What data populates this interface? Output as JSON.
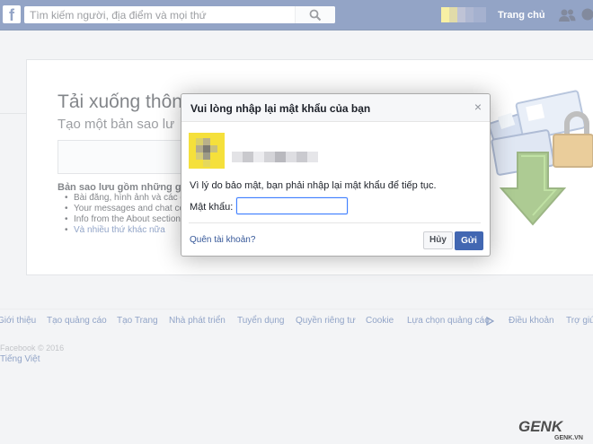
{
  "topbar": {
    "logo_letter": "f",
    "search_placeholder": "Tìm kiếm người, địa điểm và mọi thứ",
    "home_label": "Trang chủ"
  },
  "page": {
    "title": "Tải xuống thôn",
    "subtitle": "Tạo một bản sao lư",
    "backup_title": "Bản sao lưu gồm những g",
    "bullets": [
      "Bài đăng, hình ảnh và các đ",
      "Your messages and chat con",
      "Info from the About section o",
      "Và nhiều thứ khác nữa"
    ]
  },
  "footer": {
    "links": [
      "Giới thiệu",
      "Tạo quảng cáo",
      "Tạo Trang",
      "Nhà phát triển",
      "Tuyển dụng",
      "Quyền riêng tư",
      "Cookie",
      "Lựa chọn quảng cáo",
      "Điều khoản",
      "Trợ giú"
    ],
    "copyright": "Facebook © 2016",
    "language": "Tiếng Việt"
  },
  "modal": {
    "title": "Vui lòng nhập lại mật khẩu của bạn",
    "close_glyph": "×",
    "message": "Vì lý do bảo mật, bạn phải nhập lại mật khẩu để tiếp tục.",
    "password_label": "Mật khẩu:",
    "password_value": "",
    "forgot_link": "Quên tài khoản?",
    "cancel_label": "Hủy",
    "send_label": "Gửi"
  },
  "watermark": {
    "brand": "GENK",
    "domain": "GENK.VN"
  },
  "colors": {
    "topbar": "#3b5998",
    "link": "#365899",
    "primary_button": "#4267b2",
    "input_focus": "#4080ff"
  },
  "icons": [
    "facebook-logo-icon",
    "search-icon",
    "friends-icon",
    "messages-icon",
    "close-icon",
    "adchoices-icon"
  ]
}
